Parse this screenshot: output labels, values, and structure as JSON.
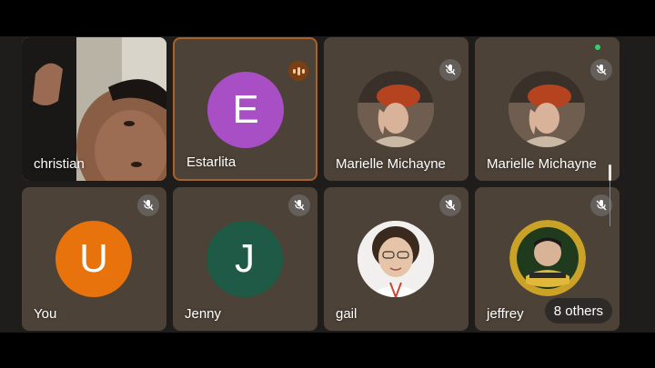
{
  "participants": [
    {
      "name": "christian",
      "type": "video"
    },
    {
      "name": "Estarlita",
      "type": "initial",
      "initial": "E",
      "color": "#a94fc6",
      "speaking": true
    },
    {
      "name": "Marielle Michayne",
      "type": "photo",
      "muted": true
    },
    {
      "name": "Marielle Michayne",
      "type": "photo",
      "muted": true
    },
    {
      "name": "You",
      "type": "initial",
      "initial": "U",
      "color": "#e8720c",
      "muted": true
    },
    {
      "name": "Jenny",
      "type": "initial",
      "initial": "J",
      "color": "#1e5a45",
      "muted": true
    },
    {
      "name": "gail",
      "type": "photo",
      "muted": true
    },
    {
      "name": "jeffrey",
      "type": "photo",
      "muted": true
    }
  ],
  "others_label": "8 others",
  "colors": {
    "tile_bg": "#4d4237",
    "speaking_border": "#a8622a",
    "status_dot": "#2fd26a"
  }
}
